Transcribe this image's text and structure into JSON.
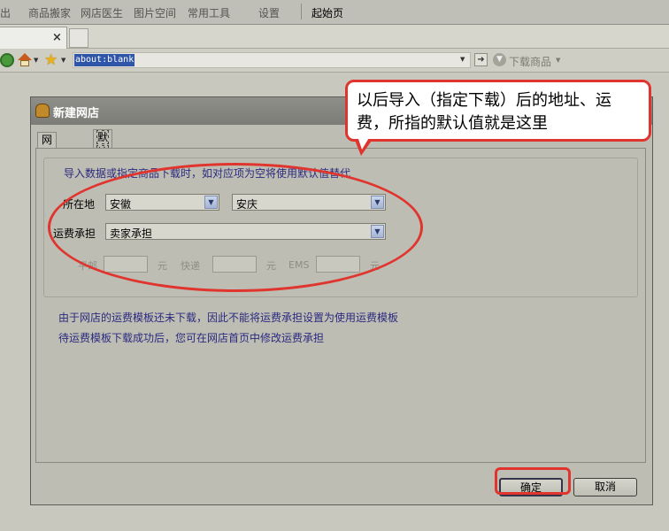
{
  "menubar": {
    "items": [
      "出",
      "商品搬家",
      "网店医生",
      "图片空间",
      "常用工具",
      "设置",
      "起始页"
    ]
  },
  "browser": {
    "tab_close": "×",
    "address": "about:blank",
    "download_label": "下载商品"
  },
  "dialog": {
    "title": "新建网店",
    "tabs": [
      "网店账号",
      "默认值"
    ],
    "hint": "导入数据或指定商品下载时，如对应项为空将使用默认值替代",
    "location_label": "所在地",
    "province": "安徽",
    "city": "安庆",
    "shipping_label": "运费承担",
    "shipping_value": "卖家承担",
    "rate_labels": {
      "mail": "平邮",
      "express": "快递",
      "ems": "EMS",
      "unit": "元"
    },
    "note_line1": "由于网店的运费模板还未下载，因此不能将运费承担设置为使用运费模板",
    "note_line2": "待运费模板下载成功后，您可在网店首页中修改运费承担",
    "ok_label": "确定",
    "cancel_label": "取消"
  },
  "annotation": {
    "line1": "以后导入（指定下载）后的地址、运",
    "line2": "费，所指的默认值就是这里",
    "color": "#e0352e"
  }
}
